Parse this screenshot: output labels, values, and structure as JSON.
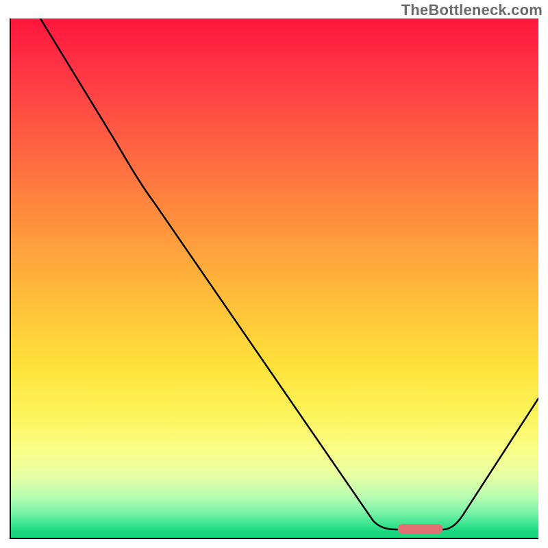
{
  "watermark": "TheBottleneck.com",
  "colors": {
    "gradient_top": "#ff153b",
    "gradient_mid": "#ffe23a",
    "gradient_bottom": "#17d67e",
    "curve": "#000000",
    "marker": "#e37070",
    "axis": "#000000",
    "watermark_text": "#6a6a6a"
  },
  "chart_data": {
    "type": "line",
    "title": "",
    "xlabel": "",
    "ylabel": "",
    "xlim": [
      0,
      100
    ],
    "ylim": [
      0,
      100
    ],
    "series": [
      {
        "name": "bottleneck-curve",
        "x": [
          5,
          20,
          27,
          68,
          73,
          82,
          86,
          100
        ],
        "values": [
          100,
          77,
          65,
          3.3,
          1.6,
          1.6,
          4.5,
          27
        ]
      }
    ],
    "annotations": [
      {
        "name": "optimal-range-marker",
        "x_start": 73,
        "x_end": 82,
        "y": 1.6,
        "color": "#e37070"
      }
    ],
    "background_gradient": {
      "direction": "vertical",
      "stops": [
        {
          "pos": 0.0,
          "color": "#ff153b"
        },
        {
          "pos": 0.37,
          "color": "#ff8a3e"
        },
        {
          "pos": 0.67,
          "color": "#ffe23a"
        },
        {
          "pos": 0.88,
          "color": "#e6ffa3"
        },
        {
          "pos": 1.0,
          "color": "#17d67e"
        }
      ]
    }
  }
}
